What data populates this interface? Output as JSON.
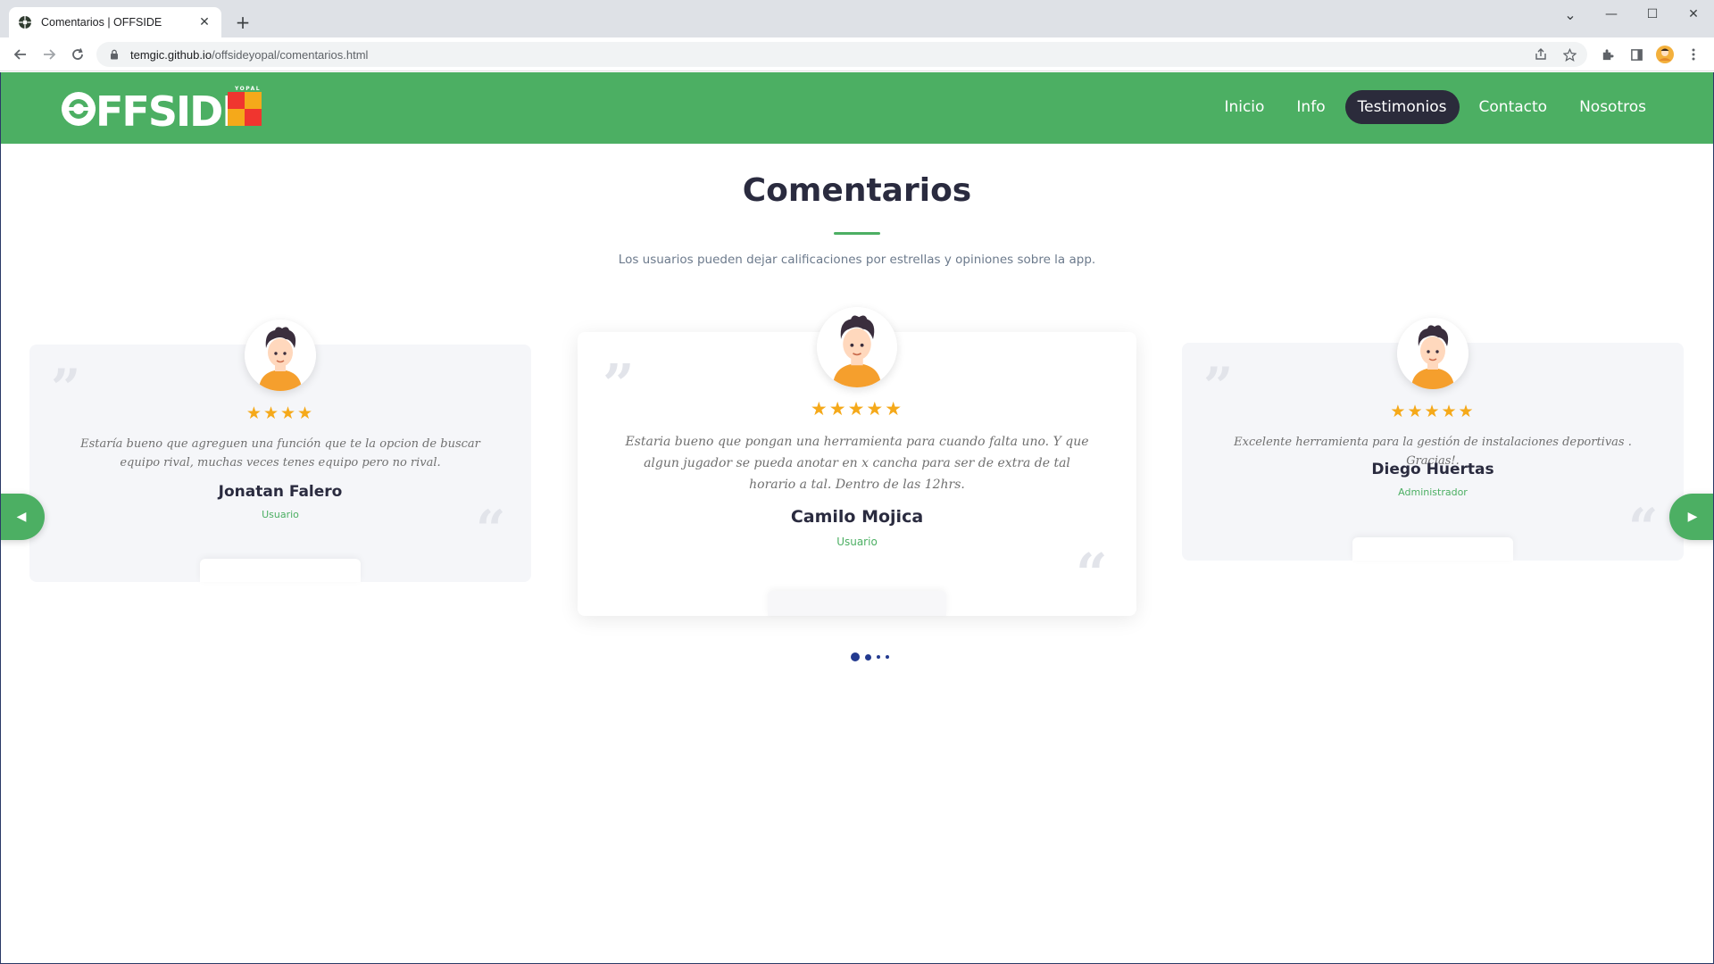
{
  "browser": {
    "tab_title": "Comentarios | OFFSIDE",
    "tab_close": "✕",
    "new_tab": "+",
    "url_host": "temgic.github.io",
    "url_path": "/offsideyopal/comentarios.html",
    "controls": {
      "minimize": "—",
      "maximize": "☐",
      "close": "✕",
      "dropdown": "⌄"
    }
  },
  "header": {
    "logo_text": "FFSIDE",
    "logo_sub": "YOPAL",
    "nav": [
      {
        "label": "Inicio",
        "active": false
      },
      {
        "label": "Info",
        "active": false
      },
      {
        "label": "Testimonios",
        "active": true
      },
      {
        "label": "Contacto",
        "active": false
      },
      {
        "label": "Nosotros",
        "active": false
      }
    ]
  },
  "main": {
    "title": "Comentarios",
    "subtitle": "Los usuarios pueden dejar calificaciones por estrellas y opiniones sobre la app."
  },
  "testimonials": [
    {
      "stars": "★★★★",
      "rating": 4,
      "comment": "Estaría bueno que agreguen una función que te la opcion de buscar equipo rival, muchas veces tenes equipo pero no rival.",
      "name": "Jonatan Falero",
      "role": "Usuario"
    },
    {
      "stars": "★★★★★",
      "rating": 5,
      "comment": "Estaria bueno que pongan una herramienta para cuando falta uno. Y que algun jugador se pueda anotar en x cancha para ser de extra de tal horario a tal. Dentro de las 12hrs.",
      "name": "Camilo Mojica",
      "role": "Usuario"
    },
    {
      "stars": "★★★★★",
      "rating": 5,
      "comment": "Excelente herramienta para la gestión de instalaciones deportivas . Gracias!.",
      "name": "Diego Huertas",
      "role": "Administrador"
    }
  ],
  "carousel": {
    "prev": "◀",
    "next": "▶",
    "active_index": 0,
    "dot_count": 4
  },
  "colors": {
    "brand_green": "#4caf63",
    "dark": "#2a2b3f",
    "star": "#f5a91a",
    "dot": "#233a8f"
  }
}
